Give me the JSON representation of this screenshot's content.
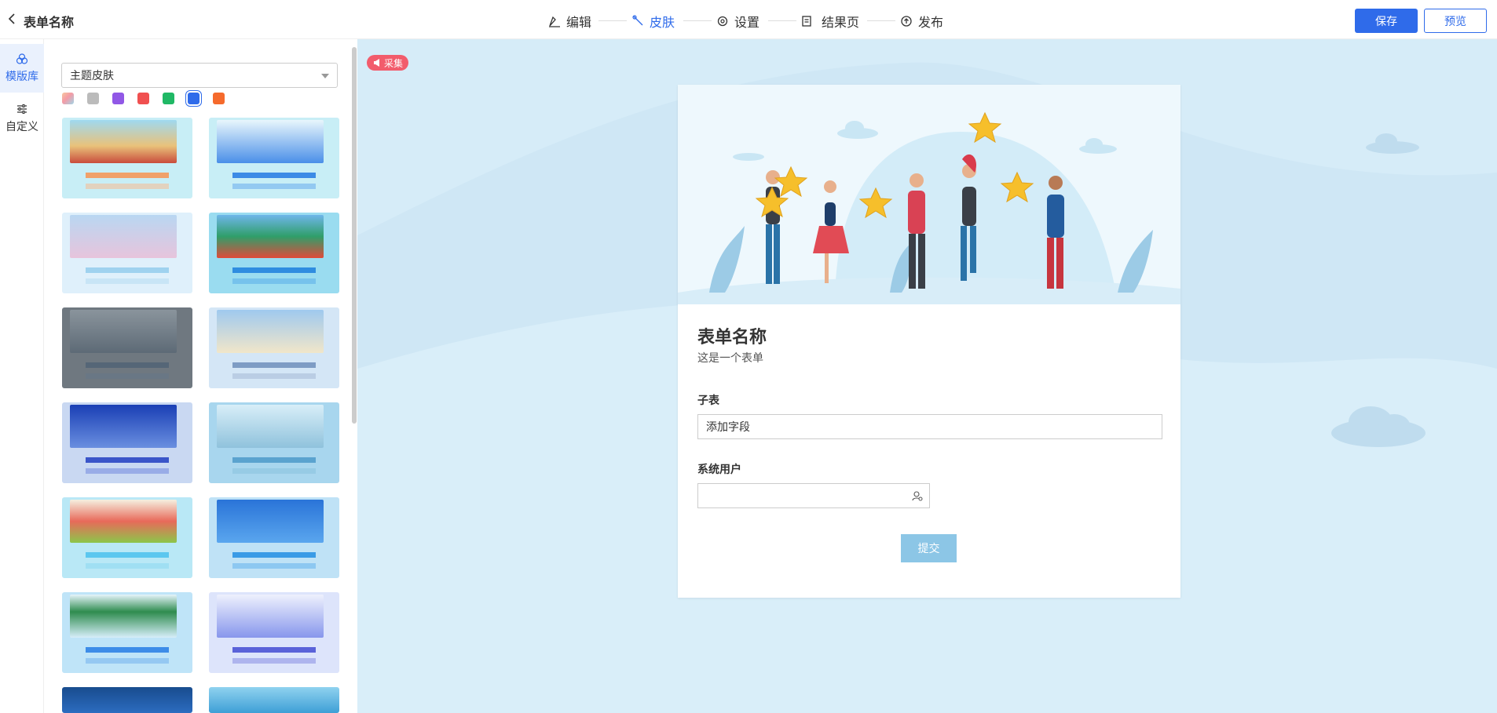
{
  "header": {
    "title": "表单名称",
    "steps": [
      {
        "label": "编辑",
        "icon": "edit-icon"
      },
      {
        "label": "皮肤",
        "icon": "skin-icon",
        "active": true
      },
      {
        "label": "设置",
        "icon": "gear-icon"
      },
      {
        "label": "结果页",
        "icon": "document-icon"
      },
      {
        "label": "发布",
        "icon": "upload-icon"
      }
    ],
    "save_label": "保存",
    "preview_label": "预览"
  },
  "rail": {
    "items": [
      {
        "label": "模版库",
        "icon": "template-library-icon",
        "active": true
      },
      {
        "label": "自定义",
        "icon": "sliders-icon"
      }
    ]
  },
  "panel": {
    "theme_select_value": "主题皮肤",
    "swatches": [
      "multicolor",
      "#bbbbbb",
      "#9158e6",
      "#f05050",
      "#20b865",
      "#2f6bea",
      "#f56a2c"
    ],
    "selected_swatch": "#2f6bea"
  },
  "canvas": {
    "collect_badge": "采集",
    "form": {
      "title": "表单名称",
      "description": "这是一个表单",
      "fields": [
        {
          "label": "子表",
          "value": "添加字段"
        },
        {
          "label": "系统用户",
          "value": "",
          "icon": "user-select-icon"
        }
      ],
      "submit_label": "提交"
    }
  }
}
